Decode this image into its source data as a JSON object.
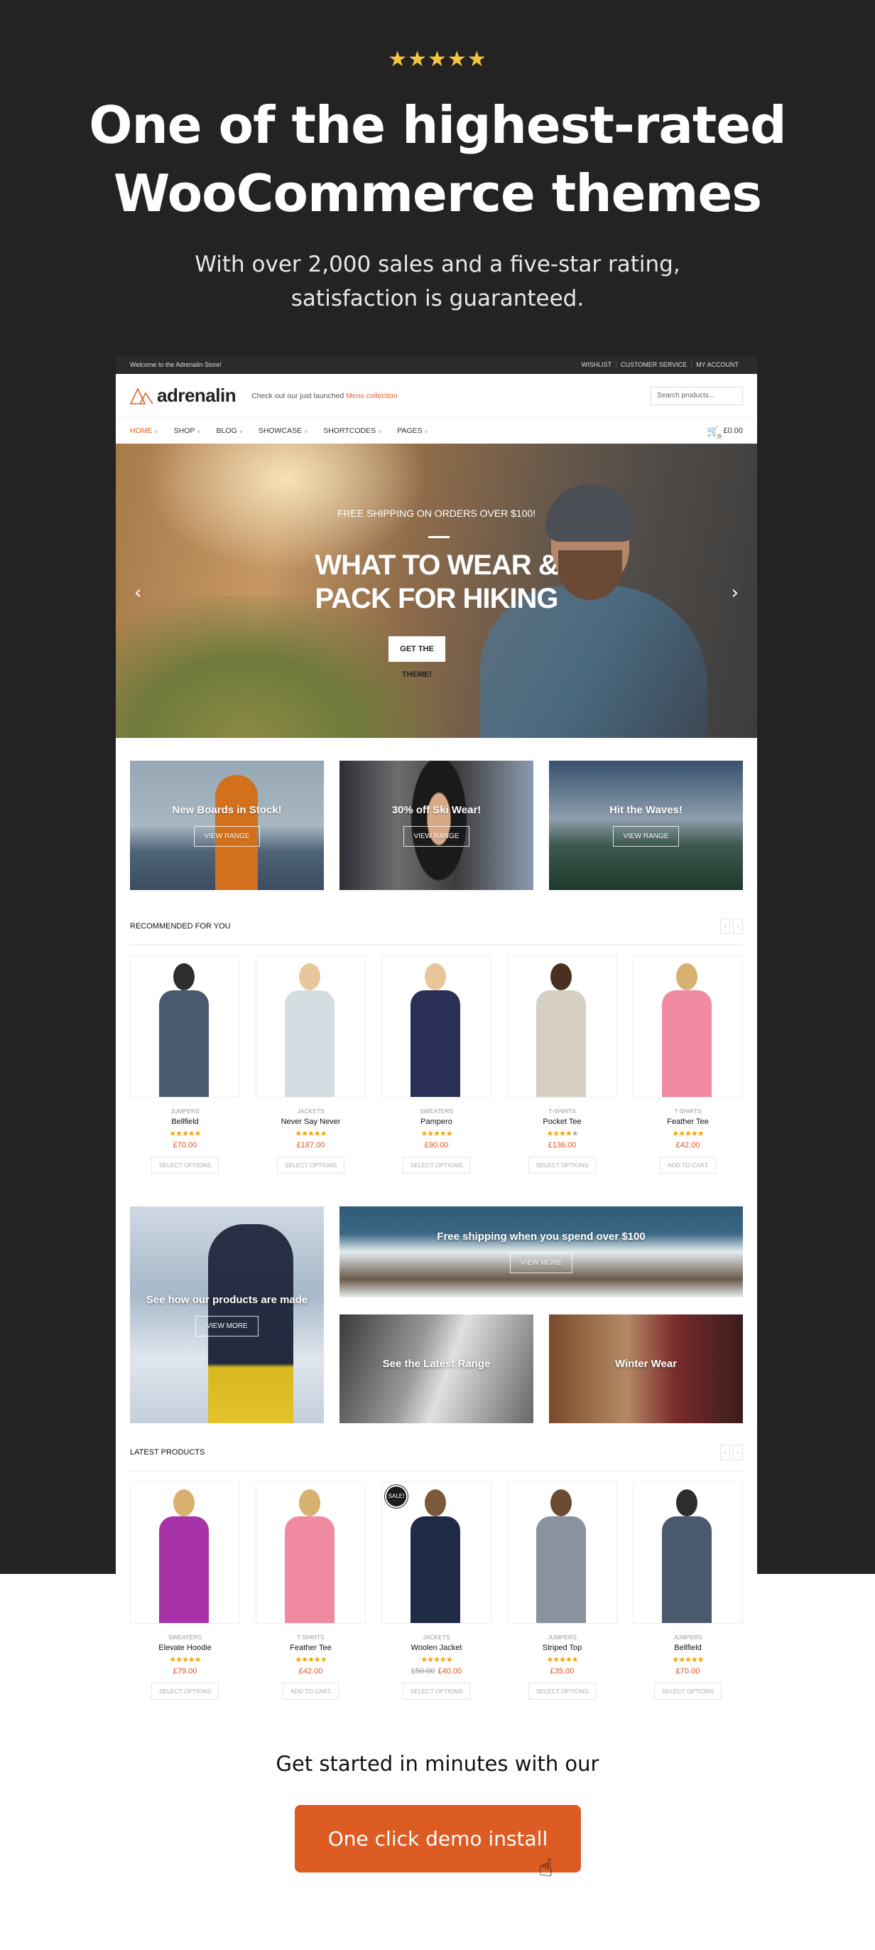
{
  "hero": {
    "stars": "★★★★★",
    "title_line1": "One of the highest-rated",
    "title_line2": "WooCommerce themes",
    "subtitle_line1": "With over 2,000 sales and a five-star rating,",
    "subtitle_line2": "satisfaction is guaranteed."
  },
  "store": {
    "topbar": {
      "welcome": "Welcome to the Adrenalin Store!",
      "links": [
        "WISHLIST",
        "CUSTOMER SERVICE",
        "MY ACCOUNT"
      ]
    },
    "logo": "adrenalin",
    "tagline_prefix": "Check out our just launched ",
    "tagline_link": "Mens collection",
    "search_placeholder": "Search products...",
    "nav": [
      "HOME",
      "SHOP",
      "BLOG",
      "SHOWCASE",
      "SHORTCODES",
      "PAGES"
    ],
    "cart": {
      "count": "0",
      "total": "£0.00"
    },
    "slider": {
      "pre": "FREE SHIPPING ON ORDERS OVER $100!",
      "heading_line1": "WHAT TO WEAR &",
      "heading_line2": "PACK FOR HIKING",
      "button": "GET THE THEME!",
      "prev": "‹",
      "next": "›"
    },
    "promos": [
      {
        "title": "New Boards in Stock!",
        "button": "VIEW RANGE"
      },
      {
        "title": "30% off Ski Wear!",
        "button": "VIEW RANGE"
      },
      {
        "title": "Hit the Waves!",
        "button": "VIEW RANGE"
      }
    ],
    "recommended": {
      "title": "RECOMMENDED FOR YOU",
      "products": [
        {
          "category": "JUMPERS",
          "name": "Bellfield",
          "rating": 4.5,
          "price": "£70.00",
          "button": "SELECT OPTIONS"
        },
        {
          "category": "JACKETS",
          "name": "Never Say Never",
          "rating": 5,
          "price": "£187.00",
          "button": "SELECT OPTIONS"
        },
        {
          "category": "SWEATERS",
          "name": "Pampero",
          "rating": 4.5,
          "price": "£90.00",
          "button": "SELECT OPTIONS"
        },
        {
          "category": "T-SHIRTS",
          "name": "Pocket Tee",
          "rating": 4,
          "price": "£136.00",
          "button": "SELECT OPTIONS"
        },
        {
          "category": "T-SHIRTS",
          "name": "Feather Tee",
          "rating": 5,
          "price": "£42.00",
          "button": "ADD TO CART"
        }
      ]
    },
    "banners": [
      {
        "title": "See how our products are made",
        "button": "VIEW MORE"
      },
      {
        "title": "Free shipping when you spend over $100",
        "button": "VIEW MORE"
      },
      {
        "title": "See the Latest Range"
      },
      {
        "title": "Winter Wear"
      }
    ],
    "latest": {
      "title": "LATEST PRODUCTS",
      "sale_badge": "SALE!",
      "products": [
        {
          "category": "SWEATERS",
          "name": "Elevate Hoodie",
          "rating": 5,
          "price": "£79.00",
          "button": "SELECT OPTIONS"
        },
        {
          "category": "T-SHIRTS",
          "name": "Feather Tee",
          "rating": 5,
          "price": "£42.00",
          "button": "ADD TO CART"
        },
        {
          "category": "JACKETS",
          "name": "Woolen Jacket",
          "rating": 4.5,
          "old_price": "£50.00",
          "price": "£40.00",
          "button": "SELECT OPTIONS",
          "sale": true
        },
        {
          "category": "JUMPERS",
          "name": "Striped Top",
          "rating": 4.5,
          "price": "£35.00",
          "button": "SELECT OPTIONS"
        },
        {
          "category": "JUMPERS",
          "name": "Bellfield",
          "rating": 4.5,
          "price": "£70.00",
          "button": "SELECT OPTIONS"
        }
      ]
    }
  },
  "cta": {
    "text": "Get started in minutes with our",
    "button": "One click demo install"
  },
  "colors": {
    "accent": "#dd5c23",
    "star_gold": "#f5c443",
    "price_red": "#d9531e",
    "dark_bg": "#232323"
  }
}
